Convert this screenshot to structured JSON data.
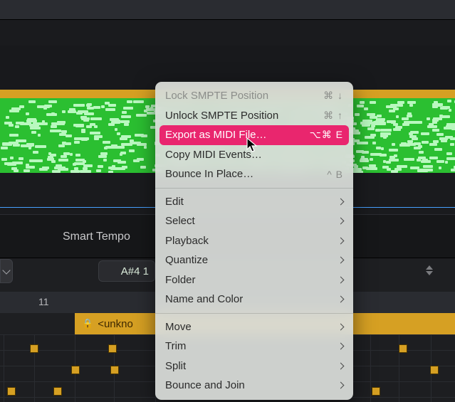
{
  "toolbar": {
    "smart_tempo_label": "Smart Tempo",
    "note_display": "A#4  1"
  },
  "ruler": {
    "bar_number": "11",
    "region_label": "<unkno"
  },
  "lock_icon_name": "lock-icon",
  "menu": {
    "lock_smpte": "Lock SMPTE Position",
    "lock_smpte_sc": "⌘ ↓",
    "unlock_smpte": "Unlock SMPTE Position",
    "unlock_smpte_sc": "⌘ ↑",
    "export_midi": "Export as MIDI File…",
    "export_midi_sc": "⌥⌘ E",
    "copy_midi": "Copy MIDI Events…",
    "bounce_in_place": "Bounce In Place…",
    "bounce_in_place_sc": "^ B",
    "edit": "Edit",
    "select": "Select",
    "playback": "Playback",
    "quantize": "Quantize",
    "folder": "Folder",
    "name_color": "Name and Color",
    "move": "Move",
    "trim": "Trim",
    "split": "Split",
    "bounce_join": "Bounce and Join"
  }
}
